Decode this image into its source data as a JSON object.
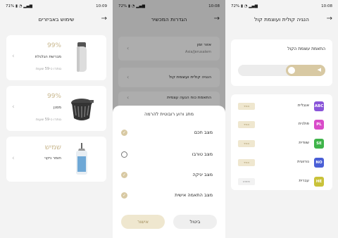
{
  "panel1": {
    "status": {
      "battery": "71%",
      "time": "10:09"
    },
    "title": "שימוש באביזרים",
    "cards": [
      {
        "pct": "99%",
        "name": "מברשת הגלגלת",
        "remaining": "נותרו כ-59 שעות",
        "icon": "roller-brush-icon"
      },
      {
        "pct": "99%",
        "name": "מסנן",
        "remaining": "נותרו כ-59 שעות",
        "icon": "filter-icon"
      },
      {
        "pct": "שמיש",
        "name": "חומר ניקוי",
        "remaining": "",
        "icon": "cleaning-solution-icon"
      }
    ],
    "colors": {
      "pct": "#c9b88f"
    }
  },
  "panel2": {
    "status": {
      "battery": "72%",
      "time": "10:08"
    },
    "title": "הגדרות המכשיר",
    "rows": [
      {
        "title": "אזור זמן",
        "subtitle": "Asia/Jerusalem"
      },
      {
        "title": "הנגיה קולית ועוצמת קול",
        "subtitle": ""
      },
      {
        "title": "התאמת כוח הנעה עצמית",
        "subtitle": ""
      }
    ],
    "sheet": {
      "title": "מתג ורוע רובוטית להרמה",
      "options": [
        {
          "label": "מצב חכם",
          "checked": true
        },
        {
          "label": "מצב טורבו",
          "checked": false
        },
        {
          "label": "מצב יניקה",
          "checked": true
        },
        {
          "label": "מצב התאמה אישית",
          "checked": true
        }
      ],
      "confirm": "אישור",
      "cancel": "ביטול"
    }
  },
  "panel3": {
    "status": {
      "battery": "72%",
      "time": "10:08"
    },
    "title": "הנגיה קולית ועוצמת קול",
    "volume_label": "התאמת עוצמת הקול",
    "volume_level": 0.45,
    "languages": [
      {
        "code": "ABC",
        "name": "אנגלית",
        "tag": "הורד",
        "color": "#8a55d9",
        "tag_active": true
      },
      {
        "code": "PL",
        "name": "פולנית",
        "tag": "הורד",
        "color": "#d94cc9",
        "tag_active": true
      },
      {
        "code": "SE",
        "name": "שוודית",
        "tag": "הורד",
        "color": "#3fb44a",
        "tag_active": true
      },
      {
        "code": "NO",
        "name": "נורווגית",
        "tag": "הורד",
        "color": "#4a5fd6",
        "tag_active": true
      },
      {
        "code": "HE",
        "name": "עברית",
        "tag": "שימוש",
        "color": "#c9c23a",
        "tag_active": false
      }
    ],
    "colors": {
      "accent": "#d8c9a3"
    }
  }
}
